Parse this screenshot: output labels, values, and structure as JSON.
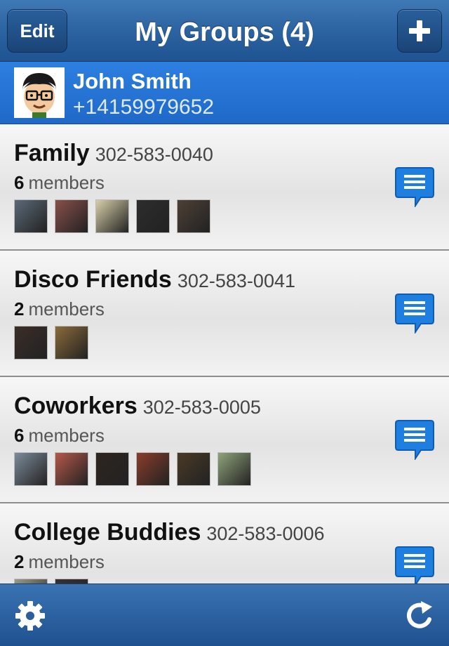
{
  "navbar": {
    "edit_label": "Edit",
    "title": "My Groups (4)",
    "add_icon": "plus-icon"
  },
  "user": {
    "name": "John Smith",
    "phone": "+14159979652",
    "avatar": "cartoon-avatar"
  },
  "groups": [
    {
      "name": "Family",
      "phone": "302-583-0040",
      "count": "6",
      "members_label": "members",
      "thumb_colors": [
        "#5b6a78",
        "#8a4f4a",
        "#d8cfa8",
        "#2d2d2d",
        "#4d4036"
      ]
    },
    {
      "name": "Disco Friends",
      "phone": "302-583-0041",
      "count": "2",
      "members_label": "members",
      "thumb_colors": [
        "#3b2d28",
        "#8b6a3a"
      ]
    },
    {
      "name": "Coworkers",
      "phone": "302-583-0005",
      "count": "6",
      "members_label": "members",
      "thumb_colors": [
        "#7d8b9a",
        "#b5584a",
        "#2f2520",
        "#8a3d2a",
        "#4a3a26",
        "#8fa37a"
      ]
    },
    {
      "name": "College Buddies",
      "phone": "302-583-0006",
      "count": "2",
      "members_label": "members",
      "thumb_colors": [
        "#9a9a8a",
        "#3a3030"
      ]
    }
  ],
  "toolbar": {
    "settings_icon": "gear-icon",
    "refresh_icon": "refresh-icon"
  },
  "colors": {
    "nav_blue": "#2c63a1",
    "selected_blue": "#2577d8",
    "message_blue": "#1f7fe0"
  }
}
